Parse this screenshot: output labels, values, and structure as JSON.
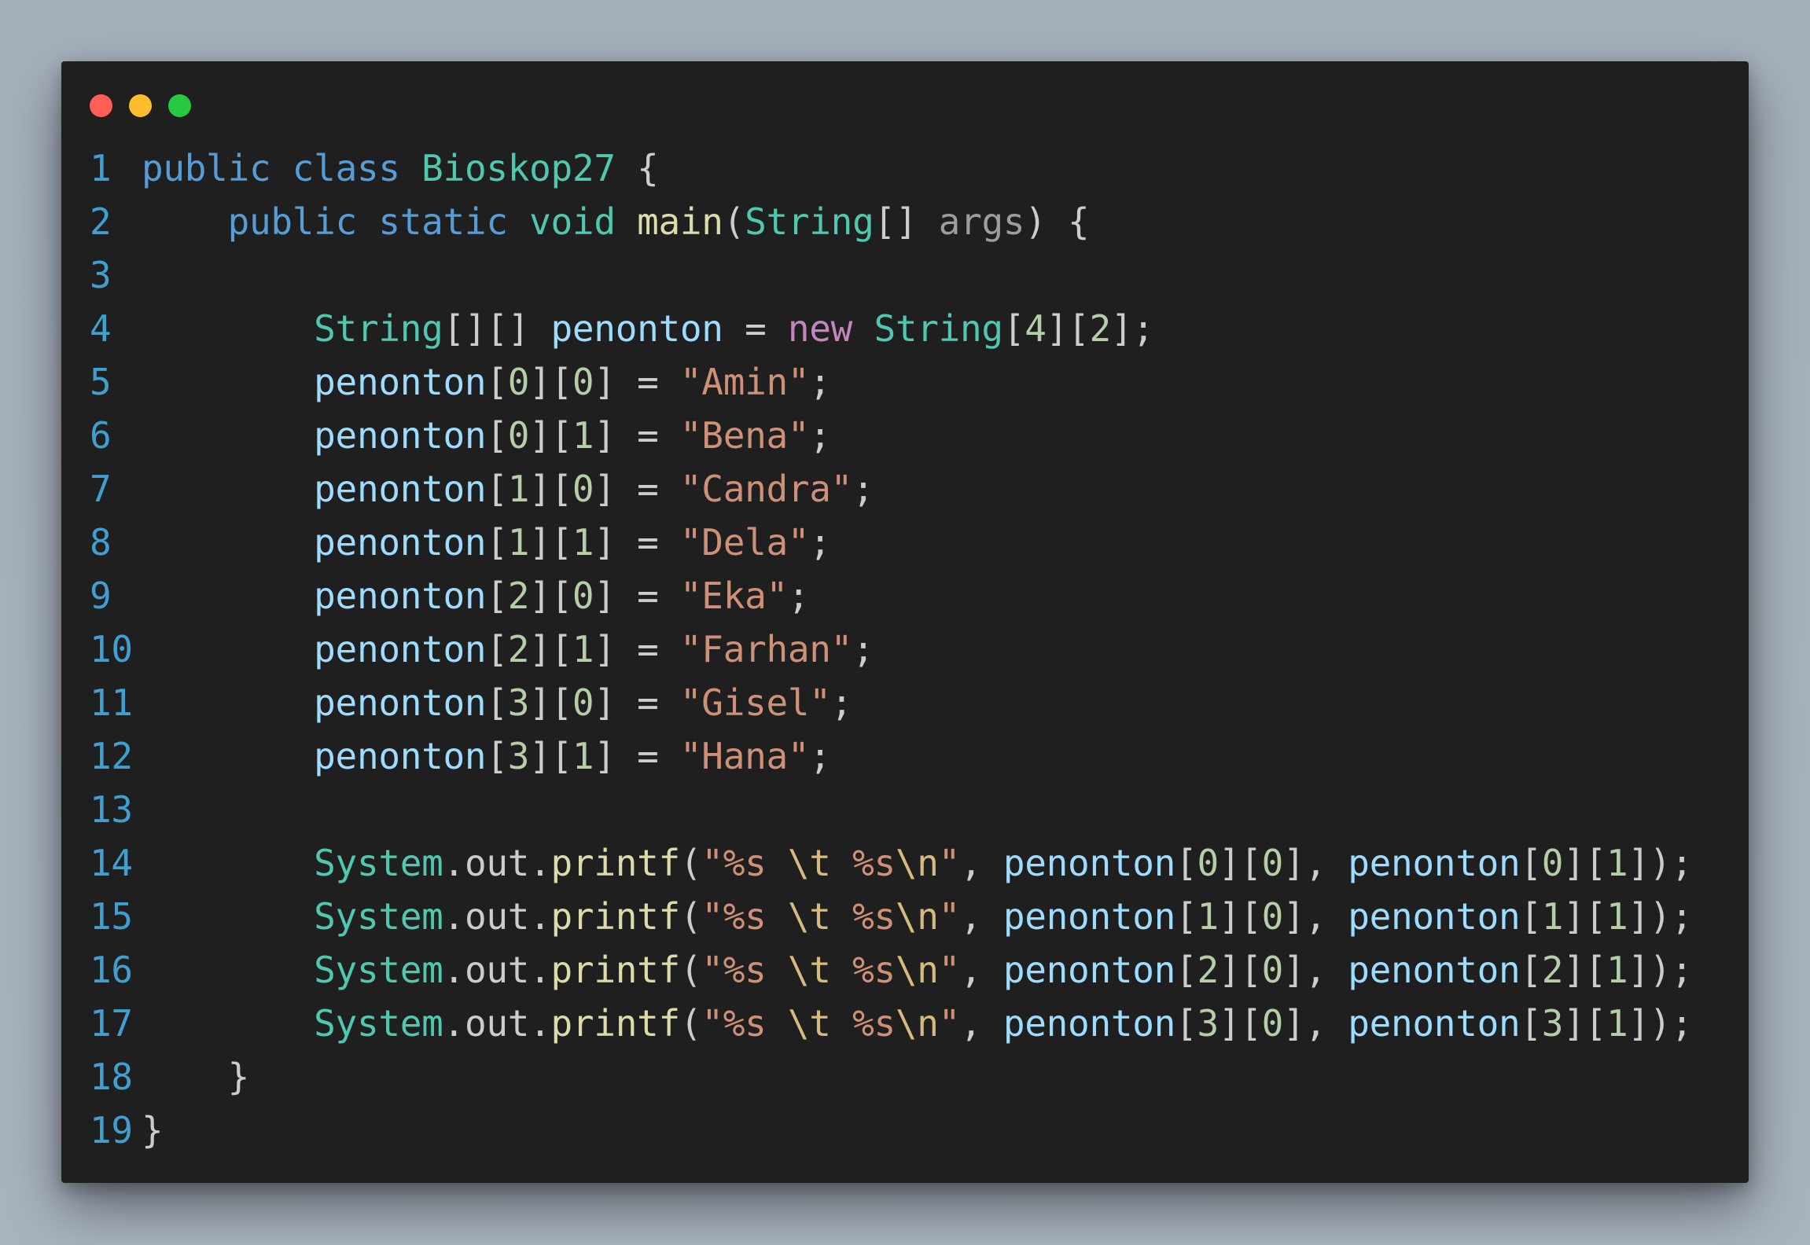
{
  "window": {
    "controls": [
      {
        "name": "close",
        "color": "#ff5f57"
      },
      {
        "name": "minimize",
        "color": "#febc2e"
      },
      {
        "name": "maximize",
        "color": "#28c840"
      }
    ]
  },
  "colors": {
    "line_number": "#3e9fd0",
    "keyword": "#569cd6",
    "type": "#4ec9b0",
    "function": "#dcdcaa",
    "variable": "#9cdcfe",
    "string": "#ce9178",
    "escape": "#d7ba7d",
    "number": "#b5cea8",
    "control": "#c586c0",
    "punct": "#cccccc",
    "param": "#9d9d9d"
  },
  "code_lines": [
    {
      "num": "1",
      "tokens": [
        {
          "t": "public",
          "c": "keyword"
        },
        {
          "t": " ",
          "c": "punct"
        },
        {
          "t": "class",
          "c": "keyword"
        },
        {
          "t": " ",
          "c": "punct"
        },
        {
          "t": "Bioskop27",
          "c": "type"
        },
        {
          "t": " {",
          "c": "punct"
        }
      ]
    },
    {
      "num": "2",
      "tokens": [
        {
          "t": "    ",
          "c": "punct"
        },
        {
          "t": "public",
          "c": "keyword"
        },
        {
          "t": " ",
          "c": "punct"
        },
        {
          "t": "static",
          "c": "keyword"
        },
        {
          "t": " ",
          "c": "punct"
        },
        {
          "t": "void",
          "c": "type"
        },
        {
          "t": " ",
          "c": "punct"
        },
        {
          "t": "main",
          "c": "function"
        },
        {
          "t": "(",
          "c": "punct"
        },
        {
          "t": "String",
          "c": "type"
        },
        {
          "t": "[] ",
          "c": "punct"
        },
        {
          "t": "args",
          "c": "param"
        },
        {
          "t": ") {",
          "c": "punct"
        }
      ]
    },
    {
      "num": "3",
      "tokens": []
    },
    {
      "num": "4",
      "tokens": [
        {
          "t": "        ",
          "c": "punct"
        },
        {
          "t": "String",
          "c": "type"
        },
        {
          "t": "[][] ",
          "c": "punct"
        },
        {
          "t": "penonton",
          "c": "variable"
        },
        {
          "t": " = ",
          "c": "punct"
        },
        {
          "t": "new",
          "c": "control"
        },
        {
          "t": " ",
          "c": "punct"
        },
        {
          "t": "String",
          "c": "type"
        },
        {
          "t": "[",
          "c": "punct"
        },
        {
          "t": "4",
          "c": "number"
        },
        {
          "t": "][",
          "c": "punct"
        },
        {
          "t": "2",
          "c": "number"
        },
        {
          "t": "];",
          "c": "punct"
        }
      ]
    },
    {
      "num": "5",
      "tokens": [
        {
          "t": "        ",
          "c": "punct"
        },
        {
          "t": "penonton",
          "c": "variable"
        },
        {
          "t": "[",
          "c": "punct"
        },
        {
          "t": "0",
          "c": "number"
        },
        {
          "t": "][",
          "c": "punct"
        },
        {
          "t": "0",
          "c": "number"
        },
        {
          "t": "] = ",
          "c": "punct"
        },
        {
          "t": "\"Amin\"",
          "c": "string"
        },
        {
          "t": ";",
          "c": "punct"
        }
      ]
    },
    {
      "num": "6",
      "tokens": [
        {
          "t": "        ",
          "c": "punct"
        },
        {
          "t": "penonton",
          "c": "variable"
        },
        {
          "t": "[",
          "c": "punct"
        },
        {
          "t": "0",
          "c": "number"
        },
        {
          "t": "][",
          "c": "punct"
        },
        {
          "t": "1",
          "c": "number"
        },
        {
          "t": "] = ",
          "c": "punct"
        },
        {
          "t": "\"Bena\"",
          "c": "string"
        },
        {
          "t": ";",
          "c": "punct"
        }
      ]
    },
    {
      "num": "7",
      "tokens": [
        {
          "t": "        ",
          "c": "punct"
        },
        {
          "t": "penonton",
          "c": "variable"
        },
        {
          "t": "[",
          "c": "punct"
        },
        {
          "t": "1",
          "c": "number"
        },
        {
          "t": "][",
          "c": "punct"
        },
        {
          "t": "0",
          "c": "number"
        },
        {
          "t": "] = ",
          "c": "punct"
        },
        {
          "t": "\"Candra\"",
          "c": "string"
        },
        {
          "t": ";",
          "c": "punct"
        }
      ]
    },
    {
      "num": "8",
      "tokens": [
        {
          "t": "        ",
          "c": "punct"
        },
        {
          "t": "penonton",
          "c": "variable"
        },
        {
          "t": "[",
          "c": "punct"
        },
        {
          "t": "1",
          "c": "number"
        },
        {
          "t": "][",
          "c": "punct"
        },
        {
          "t": "1",
          "c": "number"
        },
        {
          "t": "] = ",
          "c": "punct"
        },
        {
          "t": "\"Dela\"",
          "c": "string"
        },
        {
          "t": ";",
          "c": "punct"
        }
      ]
    },
    {
      "num": "9",
      "tokens": [
        {
          "t": "        ",
          "c": "punct"
        },
        {
          "t": "penonton",
          "c": "variable"
        },
        {
          "t": "[",
          "c": "punct"
        },
        {
          "t": "2",
          "c": "number"
        },
        {
          "t": "][",
          "c": "punct"
        },
        {
          "t": "0",
          "c": "number"
        },
        {
          "t": "] = ",
          "c": "punct"
        },
        {
          "t": "\"Eka\"",
          "c": "string"
        },
        {
          "t": ";",
          "c": "punct"
        }
      ]
    },
    {
      "num": "10",
      "tokens": [
        {
          "t": "        ",
          "c": "punct"
        },
        {
          "t": "penonton",
          "c": "variable"
        },
        {
          "t": "[",
          "c": "punct"
        },
        {
          "t": "2",
          "c": "number"
        },
        {
          "t": "][",
          "c": "punct"
        },
        {
          "t": "1",
          "c": "number"
        },
        {
          "t": "] = ",
          "c": "punct"
        },
        {
          "t": "\"Farhan\"",
          "c": "string"
        },
        {
          "t": ";",
          "c": "punct"
        }
      ]
    },
    {
      "num": "11",
      "tokens": [
        {
          "t": "        ",
          "c": "punct"
        },
        {
          "t": "penonton",
          "c": "variable"
        },
        {
          "t": "[",
          "c": "punct"
        },
        {
          "t": "3",
          "c": "number"
        },
        {
          "t": "][",
          "c": "punct"
        },
        {
          "t": "0",
          "c": "number"
        },
        {
          "t": "] = ",
          "c": "punct"
        },
        {
          "t": "\"Gisel\"",
          "c": "string"
        },
        {
          "t": ";",
          "c": "punct"
        }
      ]
    },
    {
      "num": "12",
      "tokens": [
        {
          "t": "        ",
          "c": "punct"
        },
        {
          "t": "penonton",
          "c": "variable"
        },
        {
          "t": "[",
          "c": "punct"
        },
        {
          "t": "3",
          "c": "number"
        },
        {
          "t": "][",
          "c": "punct"
        },
        {
          "t": "1",
          "c": "number"
        },
        {
          "t": "] = ",
          "c": "punct"
        },
        {
          "t": "\"Hana\"",
          "c": "string"
        },
        {
          "t": ";",
          "c": "punct"
        }
      ]
    },
    {
      "num": "13",
      "tokens": []
    },
    {
      "num": "14",
      "tokens": [
        {
          "t": "        ",
          "c": "punct"
        },
        {
          "t": "System",
          "c": "type"
        },
        {
          "t": ".",
          "c": "punct"
        },
        {
          "t": "out",
          "c": "punct"
        },
        {
          "t": ".",
          "c": "punct"
        },
        {
          "t": "printf",
          "c": "function"
        },
        {
          "t": "(",
          "c": "punct"
        },
        {
          "t": "\"%s ",
          "c": "string"
        },
        {
          "t": "\\t",
          "c": "escape"
        },
        {
          "t": " %s",
          "c": "string"
        },
        {
          "t": "\\n",
          "c": "escape"
        },
        {
          "t": "\"",
          "c": "string"
        },
        {
          "t": ", ",
          "c": "punct"
        },
        {
          "t": "penonton",
          "c": "variable"
        },
        {
          "t": "[",
          "c": "punct"
        },
        {
          "t": "0",
          "c": "number"
        },
        {
          "t": "][",
          "c": "punct"
        },
        {
          "t": "0",
          "c": "number"
        },
        {
          "t": "], ",
          "c": "punct"
        },
        {
          "t": "penonton",
          "c": "variable"
        },
        {
          "t": "[",
          "c": "punct"
        },
        {
          "t": "0",
          "c": "number"
        },
        {
          "t": "][",
          "c": "punct"
        },
        {
          "t": "1",
          "c": "number"
        },
        {
          "t": "]);",
          "c": "punct"
        }
      ]
    },
    {
      "num": "15",
      "tokens": [
        {
          "t": "        ",
          "c": "punct"
        },
        {
          "t": "System",
          "c": "type"
        },
        {
          "t": ".",
          "c": "punct"
        },
        {
          "t": "out",
          "c": "punct"
        },
        {
          "t": ".",
          "c": "punct"
        },
        {
          "t": "printf",
          "c": "function"
        },
        {
          "t": "(",
          "c": "punct"
        },
        {
          "t": "\"%s ",
          "c": "string"
        },
        {
          "t": "\\t",
          "c": "escape"
        },
        {
          "t": " %s",
          "c": "string"
        },
        {
          "t": "\\n",
          "c": "escape"
        },
        {
          "t": "\"",
          "c": "string"
        },
        {
          "t": ", ",
          "c": "punct"
        },
        {
          "t": "penonton",
          "c": "variable"
        },
        {
          "t": "[",
          "c": "punct"
        },
        {
          "t": "1",
          "c": "number"
        },
        {
          "t": "][",
          "c": "punct"
        },
        {
          "t": "0",
          "c": "number"
        },
        {
          "t": "], ",
          "c": "punct"
        },
        {
          "t": "penonton",
          "c": "variable"
        },
        {
          "t": "[",
          "c": "punct"
        },
        {
          "t": "1",
          "c": "number"
        },
        {
          "t": "][",
          "c": "punct"
        },
        {
          "t": "1",
          "c": "number"
        },
        {
          "t": "]);",
          "c": "punct"
        }
      ]
    },
    {
      "num": "16",
      "tokens": [
        {
          "t": "        ",
          "c": "punct"
        },
        {
          "t": "System",
          "c": "type"
        },
        {
          "t": ".",
          "c": "punct"
        },
        {
          "t": "out",
          "c": "punct"
        },
        {
          "t": ".",
          "c": "punct"
        },
        {
          "t": "printf",
          "c": "function"
        },
        {
          "t": "(",
          "c": "punct"
        },
        {
          "t": "\"%s ",
          "c": "string"
        },
        {
          "t": "\\t",
          "c": "escape"
        },
        {
          "t": " %s",
          "c": "string"
        },
        {
          "t": "\\n",
          "c": "escape"
        },
        {
          "t": "\"",
          "c": "string"
        },
        {
          "t": ", ",
          "c": "punct"
        },
        {
          "t": "penonton",
          "c": "variable"
        },
        {
          "t": "[",
          "c": "punct"
        },
        {
          "t": "2",
          "c": "number"
        },
        {
          "t": "][",
          "c": "punct"
        },
        {
          "t": "0",
          "c": "number"
        },
        {
          "t": "], ",
          "c": "punct"
        },
        {
          "t": "penonton",
          "c": "variable"
        },
        {
          "t": "[",
          "c": "punct"
        },
        {
          "t": "2",
          "c": "number"
        },
        {
          "t": "][",
          "c": "punct"
        },
        {
          "t": "1",
          "c": "number"
        },
        {
          "t": "]);",
          "c": "punct"
        }
      ]
    },
    {
      "num": "17",
      "tokens": [
        {
          "t": "        ",
          "c": "punct"
        },
        {
          "t": "System",
          "c": "type"
        },
        {
          "t": ".",
          "c": "punct"
        },
        {
          "t": "out",
          "c": "punct"
        },
        {
          "t": ".",
          "c": "punct"
        },
        {
          "t": "printf",
          "c": "function"
        },
        {
          "t": "(",
          "c": "punct"
        },
        {
          "t": "\"%s ",
          "c": "string"
        },
        {
          "t": "\\t",
          "c": "escape"
        },
        {
          "t": " %s",
          "c": "string"
        },
        {
          "t": "\\n",
          "c": "escape"
        },
        {
          "t": "\"",
          "c": "string"
        },
        {
          "t": ", ",
          "c": "punct"
        },
        {
          "t": "penonton",
          "c": "variable"
        },
        {
          "t": "[",
          "c": "punct"
        },
        {
          "t": "3",
          "c": "number"
        },
        {
          "t": "][",
          "c": "punct"
        },
        {
          "t": "0",
          "c": "number"
        },
        {
          "t": "], ",
          "c": "punct"
        },
        {
          "t": "penonton",
          "c": "variable"
        },
        {
          "t": "[",
          "c": "punct"
        },
        {
          "t": "3",
          "c": "number"
        },
        {
          "t": "][",
          "c": "punct"
        },
        {
          "t": "1",
          "c": "number"
        },
        {
          "t": "]);",
          "c": "punct"
        }
      ]
    },
    {
      "num": "18",
      "tokens": [
        {
          "t": "    }",
          "c": "punct"
        }
      ]
    },
    {
      "num": "19",
      "tokens": [
        {
          "t": "}",
          "c": "punct"
        }
      ]
    }
  ]
}
